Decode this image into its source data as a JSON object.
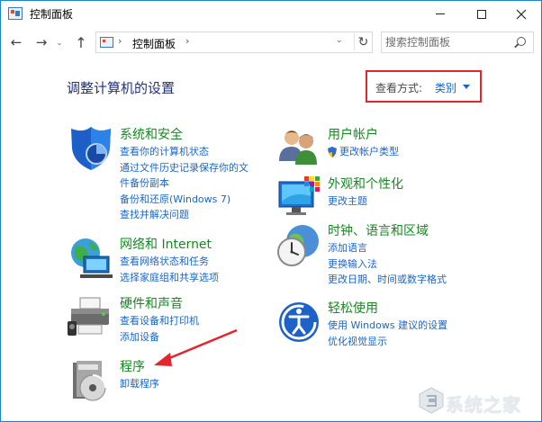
{
  "window": {
    "title": "控制面板",
    "controls": {
      "minimize": "minimize-icon",
      "maximize": "maximize-icon",
      "close": "close-icon"
    }
  },
  "nav": {
    "back_icon": "←",
    "forward_icon": "→",
    "recent_icon": "⌄",
    "up_icon": "↑",
    "address": "控制面板",
    "refresh_icon": "↻",
    "search_placeholder": "搜索控制面板"
  },
  "heading": "调整计算机的设置",
  "view": {
    "label": "查看方式:",
    "value": "类别"
  },
  "categories": {
    "system": {
      "title": "系统和安全",
      "links": [
        "查看你的计算机状态",
        "通过文件历史记录保存你的文",
        "件备份副本",
        "备份和还原(Windows 7)",
        "查找并解决问题"
      ]
    },
    "network": {
      "title": "网络和 Internet",
      "links": [
        "查看网络状态和任务",
        "选择家庭组和共享选项"
      ]
    },
    "hardware": {
      "title": "硬件和声音",
      "links": [
        "查看设备和打印机",
        "添加设备"
      ]
    },
    "programs": {
      "title": "程序",
      "links": [
        "卸载程序"
      ]
    },
    "accounts": {
      "title": "用户帐户",
      "links": [
        "更改帐户类型"
      ]
    },
    "appearance": {
      "title": "外观和个性化",
      "links": [
        "更改主题"
      ]
    },
    "clock": {
      "title": "时钟、语言和区域",
      "links": [
        "添加语言",
        "更换输入法",
        "更改日期、时间或数字格式"
      ]
    },
    "ease": {
      "title": "轻松使用",
      "links": [
        "使用 Windows 建议的设置",
        "优化视觉显示"
      ]
    }
  },
  "watermark": "系统之家",
  "colors": {
    "title_green": "#138a1f",
    "link_blue": "#1a66c8",
    "heading_blue": "#1e3287",
    "highlight_red": "#e3262e",
    "window_border": "#1883d7"
  }
}
